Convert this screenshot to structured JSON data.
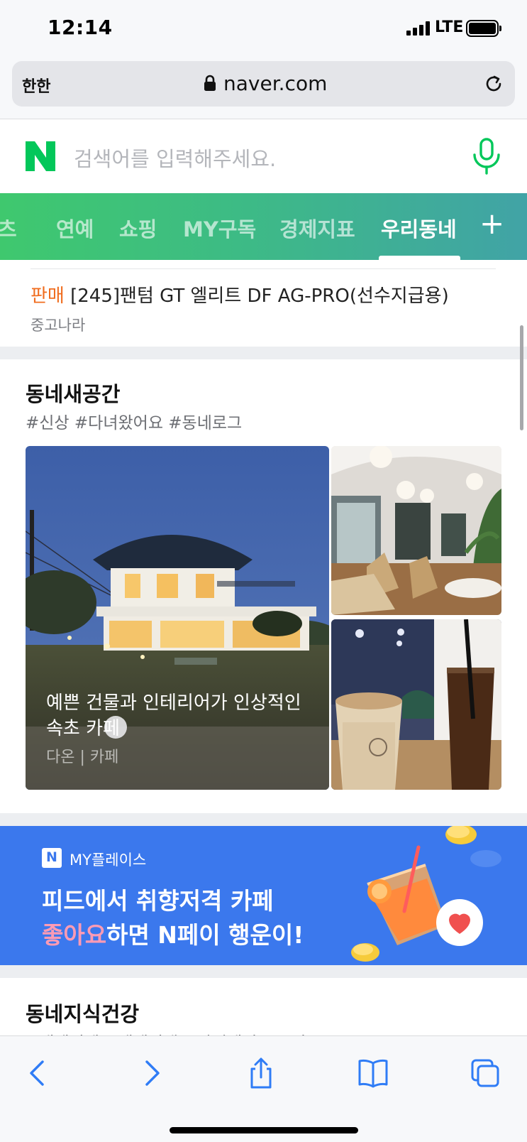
{
  "status_bar": {
    "time": "12:14",
    "network": "LTE"
  },
  "browser": {
    "aa_label": "한한",
    "url": "naver.com"
  },
  "search": {
    "placeholder": "검색어를 입력해주세요."
  },
  "tabs": [
    {
      "label": "츠"
    },
    {
      "label": "연예"
    },
    {
      "label": "쇼핑"
    },
    {
      "label": "MY구독"
    },
    {
      "label": "경제지표"
    },
    {
      "label": "우리동네",
      "active": true
    }
  ],
  "tab_add_label": "+",
  "listing": {
    "badge": "판매",
    "title": "[245]팬텀 GT 엘리트 DF AG-PRO(선수지급용)",
    "source": "중고나라"
  },
  "section_new_spaces": {
    "title": "동네새공간",
    "tags": "#신상 #다녀왔어요 #동네로그",
    "feature": {
      "caption": "예쁜 건물과 인테리어가 인상적인 속초 카페",
      "meta": "다온 | 카페"
    }
  },
  "banner": {
    "brand": "N",
    "label": "MY플레이스",
    "line1": "피드에서 취향저격 카페",
    "line2_highlight": "좋아요",
    "line2_rest": "하면 N페이 행운이!"
  },
  "section_health": {
    "title": "동네지식건강",
    "tags": "#내세니데 #백세인생 #아키데미 #보건소"
  },
  "colors": {
    "naver_green": "#03c75a",
    "tab_gradient_start": "#3fc86e",
    "tab_gradient_end": "#41a3a6",
    "badge_orange": "#f06d1f",
    "banner_blue": "#3b78ed",
    "ios_blue": "#2f7cf6"
  },
  "icons": {
    "lock": "lock-icon",
    "reload": "reload-icon",
    "mic": "microphone-icon",
    "back": "back-arrow-icon",
    "forward": "forward-arrow-icon",
    "share": "share-icon",
    "bookmarks": "bookmarks-icon",
    "tabs": "tabs-icon"
  }
}
